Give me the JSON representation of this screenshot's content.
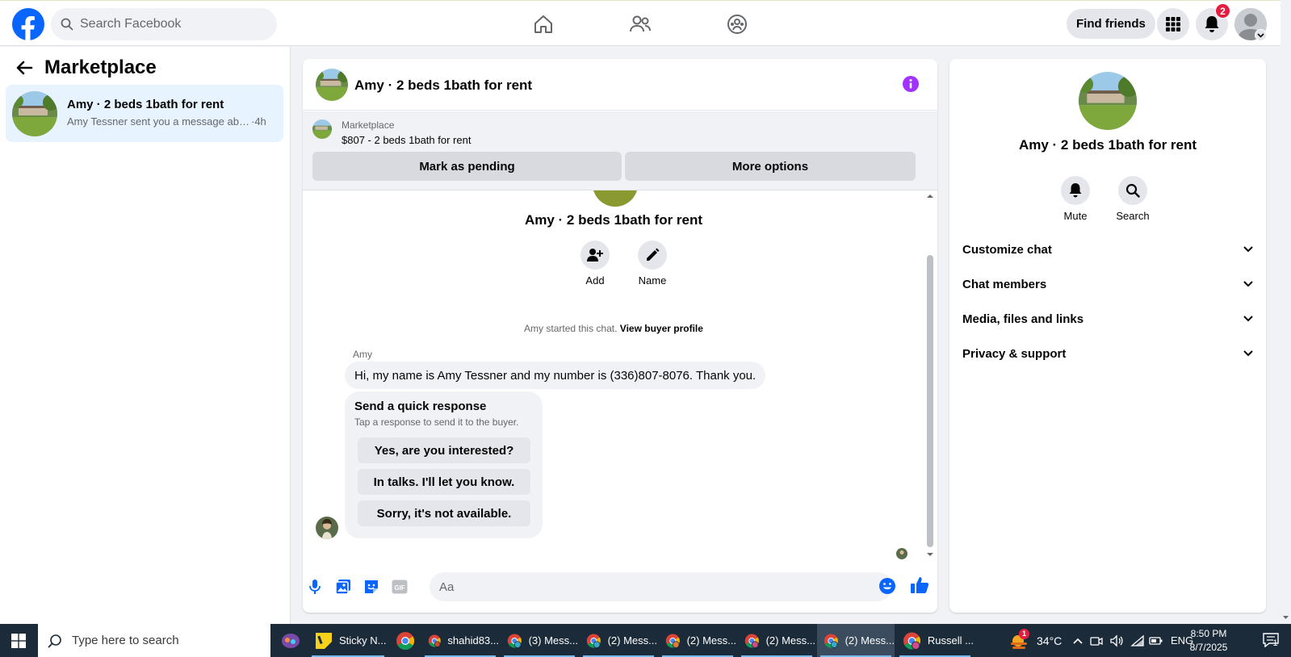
{
  "topbar": {
    "search_placeholder": "Search Facebook",
    "find_friends_label": "Find friends",
    "notification_count": "2"
  },
  "sidebar": {
    "title": "Marketplace",
    "conversations": [
      {
        "name": "Amy · 2 beds 1bath for rent",
        "snippet": "Amy Tessner sent you a message abo...",
        "time": "·4h"
      }
    ]
  },
  "chat": {
    "header_title": "Amy · 2 beds 1bath for rent",
    "listing": {
      "source": "Marketplace",
      "price_title": "$807 - 2 beds 1bath for rent",
      "mark_pending_label": "Mark as pending",
      "more_options_label": "More options"
    },
    "intro": {
      "name": "Amy · 2 beds 1bath for rent",
      "add_label": "Add",
      "name_label": "Name",
      "started_text": "Amy started this chat.",
      "view_profile_label": "View buyer profile"
    },
    "messages": [
      {
        "sender": "Amy",
        "text": "Hi, my name is Amy Tessner and my number is (336)807-8076. Thank you."
      }
    ],
    "quick_response": {
      "title": "Send a quick response",
      "subtitle": "Tap a response to send it to the buyer.",
      "options": [
        "Yes, are you interested?",
        "In talks. I'll let you know.",
        "Sorry, it's not available."
      ]
    },
    "composer_placeholder": "Aa"
  },
  "right_panel": {
    "name": "Amy · 2 beds 1bath for rent",
    "mute_label": "Mute",
    "search_label": "Search",
    "sections": [
      "Customize chat",
      "Chat members",
      "Media, files and links",
      "Privacy & support"
    ]
  },
  "taskbar": {
    "search_placeholder": "Type here to search",
    "apps": [
      {
        "label": "Sticky N...",
        "icon": "sticky-notes-icon"
      },
      {
        "label": "",
        "icon": "chrome-icon"
      },
      {
        "label": "shahid83...",
        "icon": "chrome-profile-icon"
      },
      {
        "label": "(3) Mess...",
        "icon": "chrome-profile-icon"
      },
      {
        "label": "(2) Mess...",
        "icon": "chrome-profile-icon"
      },
      {
        "label": "(2) Mess...",
        "icon": "chrome-profile-icon"
      },
      {
        "label": "(2) Mess...",
        "icon": "chrome-profile-icon"
      },
      {
        "label": "(2) Mess...",
        "icon": "chrome-profile-icon"
      },
      {
        "label": "Russell ...",
        "icon": "chrome-profile-icon"
      }
    ],
    "weather_badge": "1",
    "temperature": "34°C",
    "language": "ENG",
    "time": "8:50 PM",
    "date": "8/7/2025",
    "notification_count": "1"
  },
  "colors": {
    "brand_blue": "#0866ff",
    "selected_bg": "#e7f3ff",
    "badge_red": "#e41e3f",
    "info_purple": "#a033ff",
    "taskbar_bg": "#1c2b3a"
  }
}
